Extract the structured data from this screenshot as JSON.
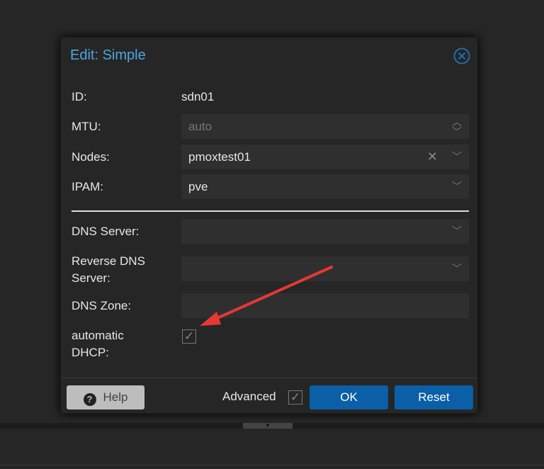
{
  "dialog": {
    "title": "Edit: Simple",
    "fields": {
      "id": {
        "label": "ID:",
        "value": "sdn01"
      },
      "mtu": {
        "label": "MTU:",
        "value": "auto"
      },
      "nodes": {
        "label": "Nodes:",
        "value": "pmoxtest01"
      },
      "ipam": {
        "label": "IPAM:",
        "value": "pve"
      },
      "dns_server": {
        "label": "DNS Server:",
        "value": ""
      },
      "reverse_dns": {
        "label_line1": "Reverse DNS",
        "label_line2": "Server:",
        "value": ""
      },
      "dns_zone": {
        "label": "DNS Zone:",
        "value": ""
      },
      "dhcp": {
        "label_line1": "automatic",
        "label_line2": "DHCP:",
        "checked": true
      }
    },
    "footer": {
      "help": "Help",
      "advanced": "Advanced",
      "advanced_checked": true,
      "ok": "OK",
      "reset": "Reset"
    }
  },
  "colors": {
    "accent": "#4ea5e0",
    "primary_button": "#0a5fa6",
    "arrow": "#e53935"
  }
}
